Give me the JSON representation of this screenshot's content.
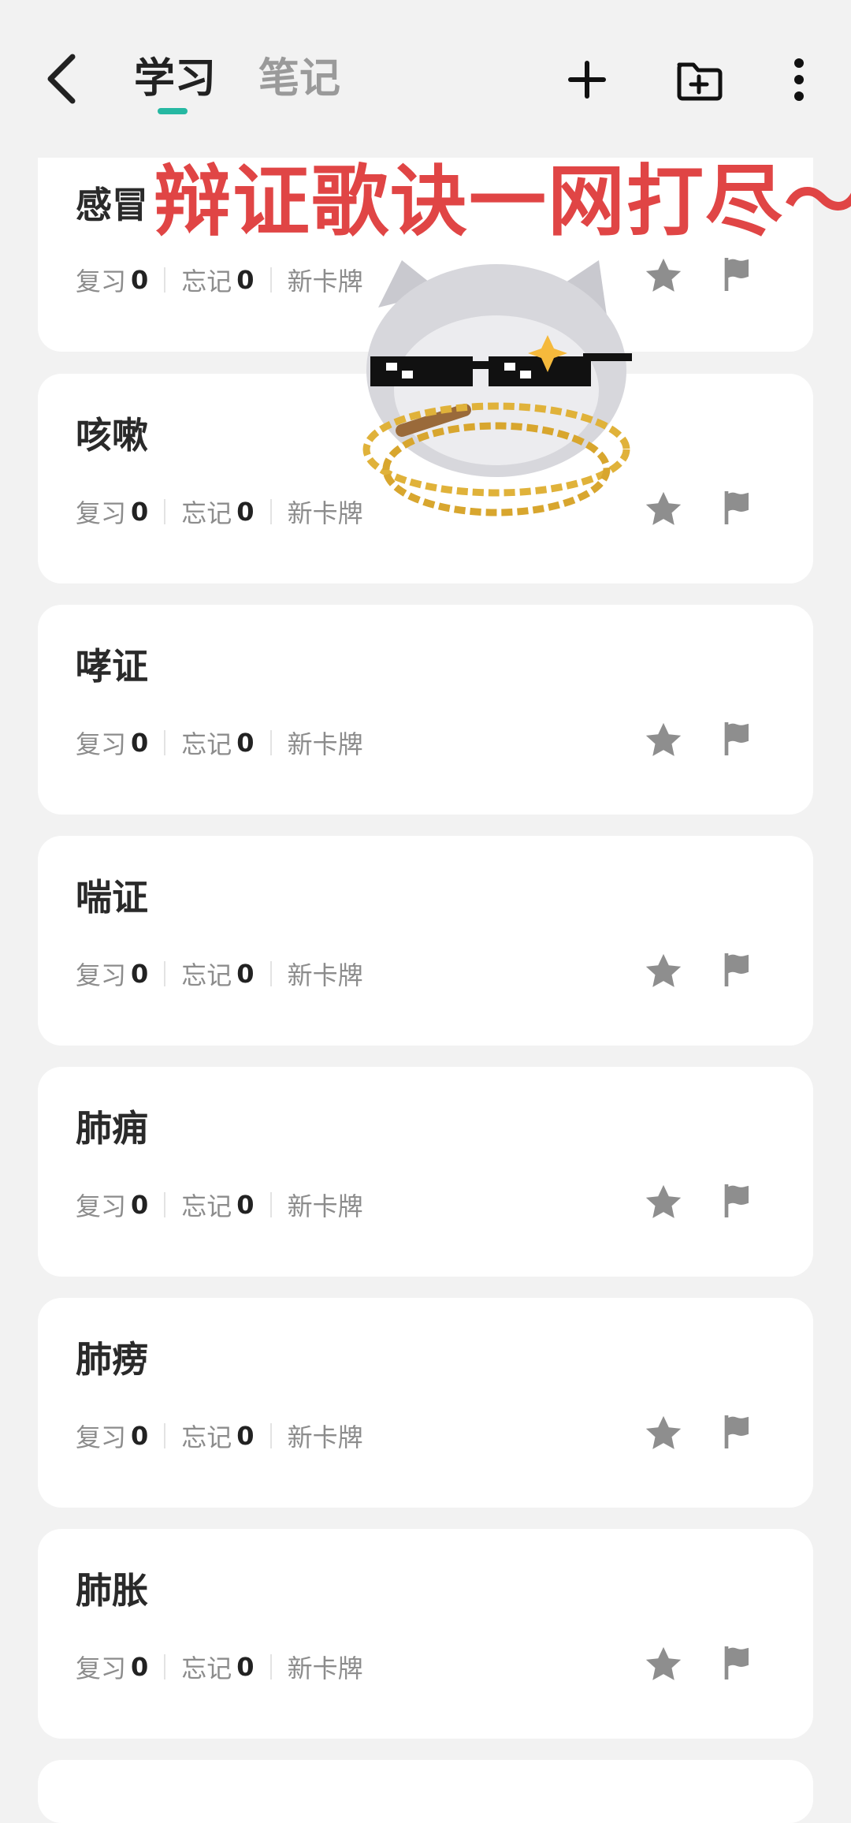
{
  "header": {
    "tabs": [
      {
        "label": "学习",
        "active": true
      },
      {
        "label": "笔记",
        "active": false
      }
    ],
    "icons": [
      "back-icon",
      "plus-icon",
      "folder-add-icon",
      "more-vertical-icon"
    ]
  },
  "colors": {
    "accent": "#26b8a2",
    "banner_text": "#e04545",
    "background": "#f2f2f2"
  },
  "overlay": {
    "banner_text": "辩证歌诀一网打尽～"
  },
  "labels": {
    "review": "复习",
    "forget": "忘记",
    "new_card": "新卡牌"
  },
  "cards": [
    {
      "title": "感冒",
      "review": "0",
      "forget": "0",
      "status": "新卡牌"
    },
    {
      "title": "咳嗽",
      "review": "0",
      "forget": "0",
      "status": "新卡牌"
    },
    {
      "title": "哮证",
      "review": "0",
      "forget": "0",
      "status": "新卡牌"
    },
    {
      "title": "喘证",
      "review": "0",
      "forget": "0",
      "status": "新卡牌"
    },
    {
      "title": "肺痈",
      "review": "0",
      "forget": "0",
      "status": "新卡牌"
    },
    {
      "title": "肺痨",
      "review": "0",
      "forget": "0",
      "status": "新卡牌"
    },
    {
      "title": "肺胀",
      "review": "0",
      "forget": "0",
      "status": "新卡牌"
    }
  ]
}
